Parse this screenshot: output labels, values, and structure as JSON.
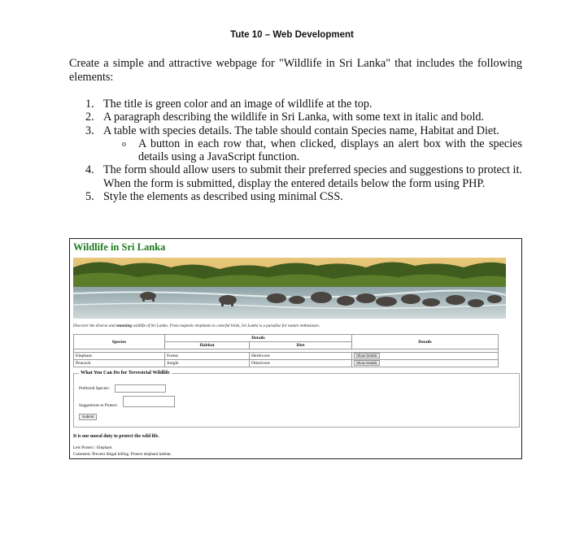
{
  "doc": {
    "title": "Tute 10 – Web Development",
    "intro": "Create a simple and attractive webpage for \"Wildlife in Sri Lanka\" that includes the following elements:",
    "items": [
      {
        "num": "1.",
        "text": "The title is green color and an image of wildlife at the top."
      },
      {
        "num": "2.",
        "text": "A paragraph describing the wildlife in Sri Lanka, with some text in italic and bold."
      },
      {
        "num": "3.",
        "text": "A table with species details. The table should contain Species name, Habitat and Diet."
      },
      {
        "num": "4.",
        "text": "The form should allow users to submit their preferred species and suggestions to protect it. When the form is submitted, display the entered details below the form using PHP."
      },
      {
        "num": "5.",
        "text": "Style the elements as described using minimal CSS."
      }
    ],
    "subitem": {
      "bullet": "o",
      "text": "A button in each row that, when clicked, displays an alert box with the species details using a JavaScript function."
    }
  },
  "shot": {
    "title": "Wildlife in Sri Lanka",
    "title_color": "#1c7a1c",
    "hero_icon": "elephant-herd-image",
    "desc_before": "Discover the diverse and ",
    "desc_bold": "stunning",
    "desc_after": " wildlife of Sri Lanka. From majestic elephants to colorful birds, Sri Lanka is a paradise for nature enthusiasts.",
    "table": {
      "species_header": "Species",
      "details_group_header": "Details",
      "habitat_header": "Habitat",
      "diet_header": "Diet",
      "details_header": "Details",
      "rows": [
        {
          "species": "Elephant",
          "habitat": "Forest",
          "diet": "Herbivore",
          "button": "Show Details"
        },
        {
          "species": "Peacock",
          "habitat": "Jungle",
          "diet": "Omnivore",
          "button": "Show Details"
        }
      ]
    },
    "form": {
      "legend": "What You Can Do for Terrestrial Wildlife",
      "species_label": "Preferred Species:",
      "suggestions_label": "Suggestions to Protect:",
      "submit": "Submit"
    },
    "moral": "It is our moral duty to protect the wild life.",
    "result_line1": "Lets Protect : Elephant",
    "result_line2": "Comment: Prevent illegal killing. Protect elephant habitat."
  }
}
